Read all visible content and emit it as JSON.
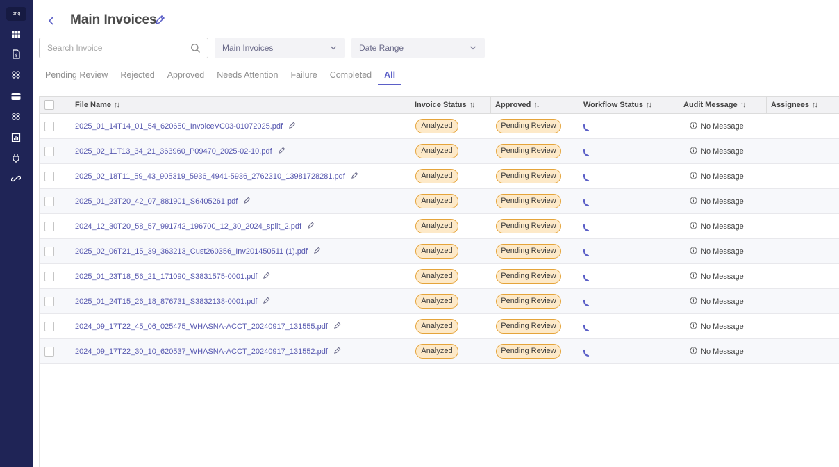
{
  "sidebar": {
    "logo_text": "briq",
    "items": [
      {
        "icon": "grid-icon"
      },
      {
        "icon": "invoice-document-icon"
      },
      {
        "icon": "workflow-link-icon"
      },
      {
        "icon": "credit-card-icon"
      },
      {
        "icon": "workflow-link-icon"
      },
      {
        "icon": "bar-chart-icon"
      },
      {
        "icon": "plug-icon"
      },
      {
        "icon": "chain-link-icon"
      }
    ]
  },
  "header": {
    "title": "Main Invoices"
  },
  "filters": {
    "search_placeholder": "Search Invoice",
    "invoice_group": "Main Invoices",
    "date_range": "Date Range"
  },
  "tabs": [
    {
      "label": "Pending Review"
    },
    {
      "label": "Rejected"
    },
    {
      "label": "Approved"
    },
    {
      "label": "Needs Attention"
    },
    {
      "label": "Failure"
    },
    {
      "label": "Completed"
    },
    {
      "label": "All",
      "active": true
    }
  ],
  "table": {
    "columns": {
      "file_name": "File Name",
      "invoice_status": "Invoice Status",
      "approved": "Approved",
      "workflow_status": "Workflow Status",
      "audit_message": "Audit Message",
      "assignees": "Assignees"
    },
    "rows": [
      {
        "file": "2025_01_14T14_01_54_620650_InvoiceVC03-01072025.pdf",
        "invoice_status": "Analyzed",
        "approved": "Pending Review",
        "audit": "No Message"
      },
      {
        "file": "2025_02_11T13_34_21_363960_P09470_2025-02-10.pdf",
        "invoice_status": "Analyzed",
        "approved": "Pending Review",
        "audit": "No Message"
      },
      {
        "file": "2025_02_18T11_59_43_905319_5936_4941-5936_2762310_13981728281.pdf",
        "invoice_status": "Analyzed",
        "approved": "Pending Review",
        "audit": "No Message"
      },
      {
        "file": "2025_01_23T20_42_07_881901_S6405261.pdf",
        "invoice_status": "Analyzed",
        "approved": "Pending Review",
        "audit": "No Message"
      },
      {
        "file": "2024_12_30T20_58_57_991742_196700_12_30_2024_split_2.pdf",
        "invoice_status": "Analyzed",
        "approved": "Pending Review",
        "audit": "No Message"
      },
      {
        "file": "2025_02_06T21_15_39_363213_Cust260356_Inv201450511 (1).pdf",
        "invoice_status": "Analyzed",
        "approved": "Pending Review",
        "audit": "No Message"
      },
      {
        "file": "2025_01_23T18_56_21_171090_S3831575-0001.pdf",
        "invoice_status": "Analyzed",
        "approved": "Pending Review",
        "audit": "No Message"
      },
      {
        "file": "2025_01_24T15_26_18_876731_S3832138-0001.pdf",
        "invoice_status": "Analyzed",
        "approved": "Pending Review",
        "audit": "No Message"
      },
      {
        "file": "2024_09_17T22_45_06_025475_WHASNA-ACCT_20240917_131555.pdf",
        "invoice_status": "Analyzed",
        "approved": "Pending Review",
        "audit": "No Message"
      },
      {
        "file": "2024_09_17T22_30_10_620537_WHASNA-ACCT_20240917_131552.pdf",
        "invoice_status": "Analyzed",
        "approved": "Pending Review",
        "audit": "No Message"
      }
    ]
  },
  "colors": {
    "sidebar_bg": "#1f2456",
    "accent": "#5b5fc7",
    "badge_bg": "#fde9c8",
    "badge_border": "#e5a43a"
  }
}
